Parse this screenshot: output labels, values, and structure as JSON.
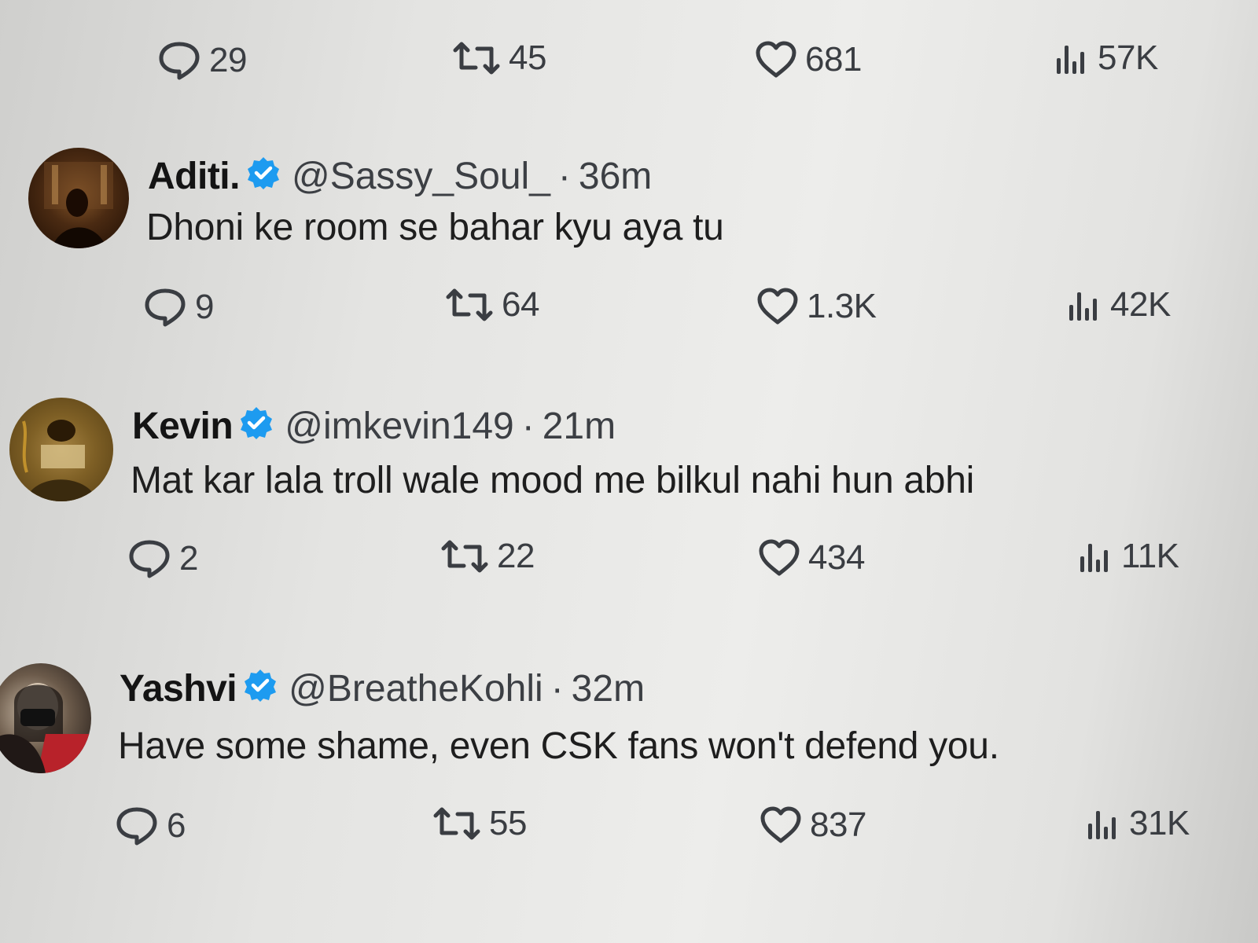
{
  "top_tweet": {
    "actions": {
      "replies": "29",
      "retweets": "45",
      "likes": "681",
      "views": "57K"
    }
  },
  "tweets": [
    {
      "name": "Aditi.",
      "handle": "@Sassy_Soul_",
      "separator": "·",
      "time": "36m",
      "text": "Dhoni ke room se bahar kyu aya tu",
      "actions": {
        "replies": "9",
        "retweets": "64",
        "likes": "1.3K",
        "views": "42K"
      }
    },
    {
      "name": "Kevin",
      "handle": "@imkevin149",
      "separator": "·",
      "time": "21m",
      "text": "Mat kar lala troll wale mood me bilkul nahi hun abhi",
      "actions": {
        "replies": "2",
        "retweets": "22",
        "likes": "434",
        "views": "11K"
      }
    },
    {
      "name": "Yashvi",
      "handle": "@BreatheKohli",
      "separator": "·",
      "time": "32m",
      "text": "Have some shame, even CSK fans won't defend you.",
      "actions": {
        "replies": "6",
        "retweets": "55",
        "likes": "837",
        "views": "31K"
      }
    }
  ],
  "colors": {
    "verified_badge": "#1d9bf0",
    "icon_gray": "#3a3d42"
  },
  "icons": {
    "reply": "reply-icon",
    "retweet": "retweet-icon",
    "like": "heart-icon",
    "views": "views-icon",
    "verified": "verified-badge-icon"
  }
}
